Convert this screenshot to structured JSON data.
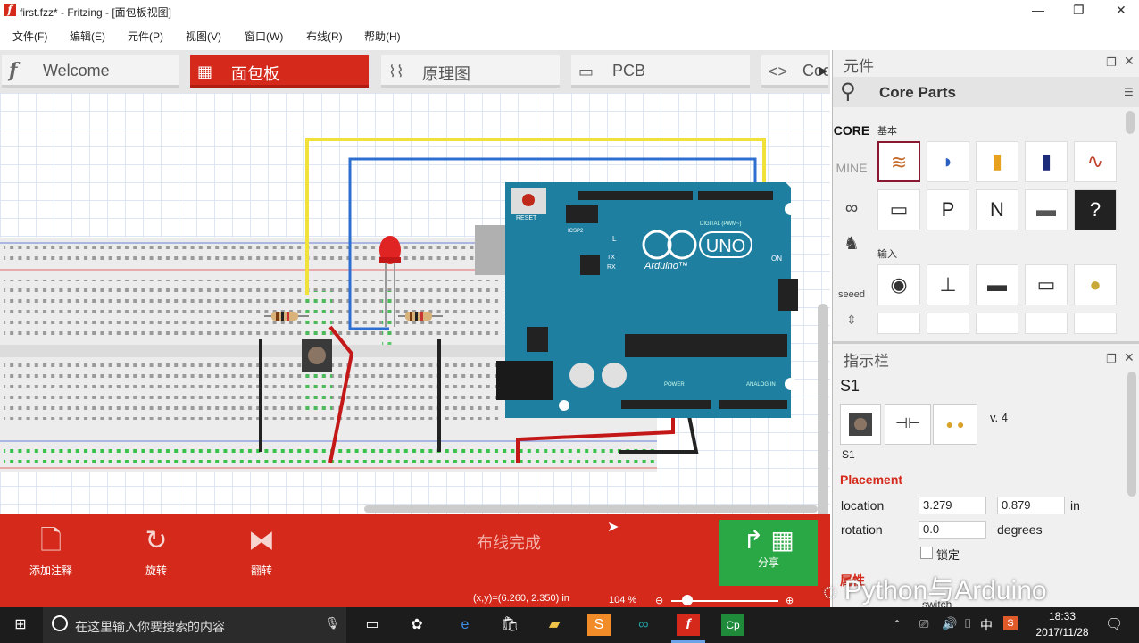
{
  "window": {
    "title": "first.fzz* - Fritzing - [面包板视图]"
  },
  "menu": [
    "文件(F)",
    "编辑(E)",
    "元件(P)",
    "视图(V)",
    "窗口(W)",
    "布线(R)",
    "帮助(H)"
  ],
  "tabs": [
    {
      "label": "Welcome",
      "icon": "fritzing-f-icon",
      "active": false
    },
    {
      "label": "面包板",
      "icon": "breadboard-icon",
      "active": true
    },
    {
      "label": "原理图",
      "icon": "schematic-icon",
      "active": false
    },
    {
      "label": "PCB",
      "icon": "pcb-icon",
      "active": false
    },
    {
      "label": "Cod",
      "icon": "code-icon",
      "active": false
    }
  ],
  "board": {
    "reset": "RESET",
    "icsp2": "ICSP2",
    "logo_uno": "UNO",
    "logo_arduino": "Arduino™",
    "on": "ON",
    "l": "L",
    "tx": "TX",
    "rx": "RX",
    "icsp": "ICSP",
    "digital": "DIGITAL (PWM~)",
    "power": "POWER",
    "analog": "ANALOG IN"
  },
  "toolbar": {
    "add_note": "添加注释",
    "rotate": "旋转",
    "flip": "翻转",
    "routing_status": "布线完成",
    "share": "分享",
    "coords": "(x,y)=(6.260, 2.350) in",
    "zoom": "104 %"
  },
  "parts_panel": {
    "title": "元件",
    "bin_title": "Core Parts",
    "section_basic": "基本",
    "section_input": "输入",
    "side_core": "CORE",
    "side_mine": "MINE",
    "side_seeed": "seeed"
  },
  "inspector": {
    "title": "指示栏",
    "part_title": "S1",
    "part_label": "S1",
    "version": "v. 4",
    "placement_header": "Placement",
    "location_label": "location",
    "location_x": "3.279",
    "location_y": "0.879",
    "location_unit": "in",
    "rotation_label": "rotation",
    "rotation_value": "0.0",
    "rotation_unit": "degrees",
    "lock_label": "锁定",
    "props_header": "属性",
    "family_value": "switch"
  },
  "watermark": "Python与Arduino",
  "taskbar": {
    "search_placeholder": "在这里输入你要搜索的内容",
    "time": "18:33",
    "date": "2017/11/28",
    "ime": "中"
  },
  "colors": {
    "accent": "#d4291b",
    "share": "#2aa845",
    "board": "#1f7fa0"
  }
}
